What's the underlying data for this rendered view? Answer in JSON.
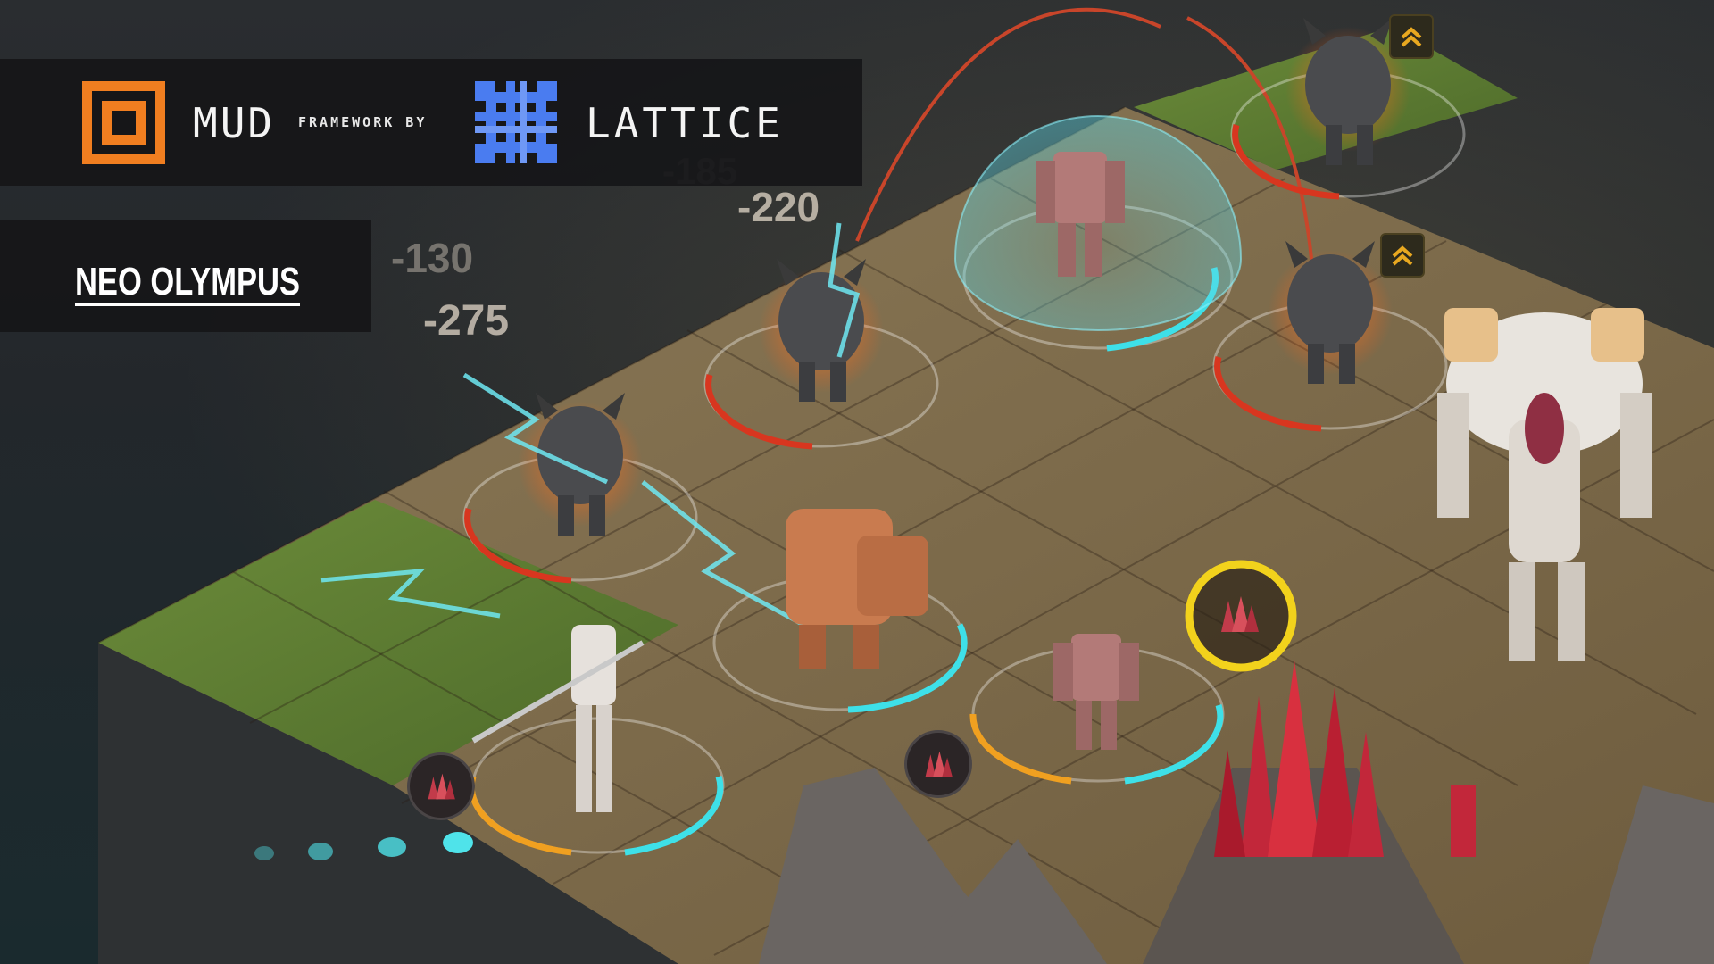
{
  "header": {
    "mud_label": "MUD",
    "framework_by": "FRAMEWORK BY",
    "lattice_label": "LATTICE",
    "mud_color": "#f07e20",
    "lattice_color": "#4a7cf0"
  },
  "game_logo": {
    "text": "NEO OLYMPUS"
  },
  "damage_numbers": [
    "-185",
    "-220",
    "-130",
    "-275"
  ],
  "icons": {
    "upgrade_badges": [
      "chevron-up-icon",
      "chevron-up-icon"
    ],
    "resource_tokens": [
      "crystal-icon",
      "crystal-icon",
      "crystal-icon"
    ]
  },
  "colors": {
    "health": "#d8361f",
    "shield": "#3ee0e8",
    "energy": "#f0a020",
    "selection": "#f2d21c"
  }
}
